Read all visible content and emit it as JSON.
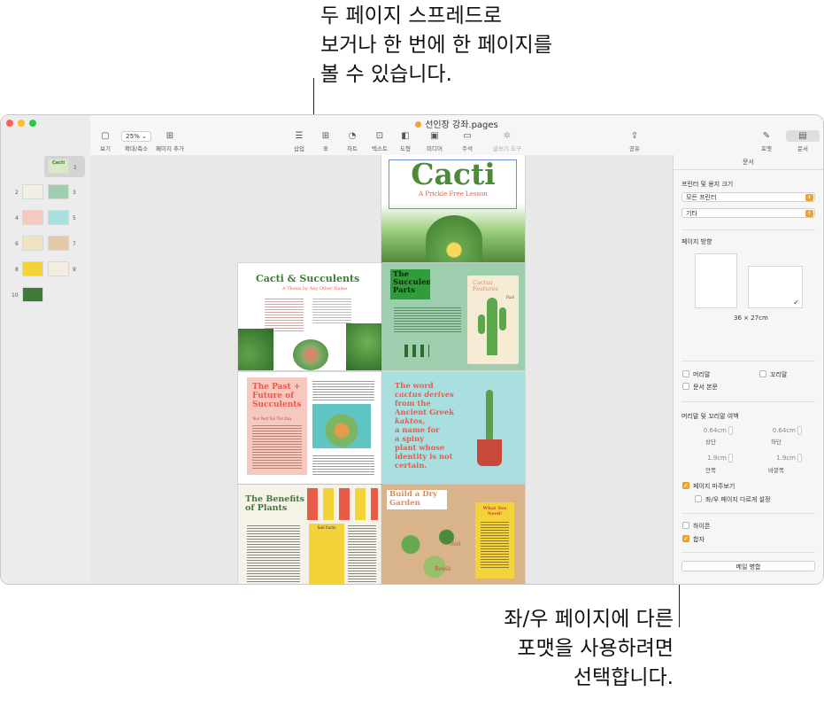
{
  "callouts": {
    "top": [
      "두 페이지 스프레드로",
      "보거나 한 번에 한 페이지를",
      "볼 수 있습니다."
    ],
    "bottom": [
      "좌/우 페이지에 다른",
      "포맷을 사용하려면",
      "선택합니다."
    ]
  },
  "window": {
    "title": "선인장 강좌.pages"
  },
  "toolbar": {
    "view": "보기",
    "zoom_value": "25%",
    "zoom_label": "확대/축소",
    "add_page": "페이지 추가",
    "insert": "삽입",
    "table": "표",
    "chart": "차트",
    "text": "텍스트",
    "shape": "도형",
    "media": "미디어",
    "comment": "주석",
    "writing_tools": "글쓰기 도구",
    "share": "공유",
    "format": "포맷",
    "document": "문서"
  },
  "sidebar": {
    "page_numbers": [
      "1",
      "2",
      "3",
      "4",
      "5",
      "6",
      "7",
      "8",
      "9",
      "10"
    ],
    "first_thumb_title": "Cacti"
  },
  "pages": {
    "p1": {
      "title": "Cacti",
      "subtitle": "A Prickle Free Lesson"
    },
    "p2": {
      "title": "Cacti & Succulents",
      "subtitle": "A Thesis by Any Other Name"
    },
    "p3": {
      "title": "The Succulent Parts",
      "side_title": "Cactus Features",
      "side_label": "Pad"
    },
    "p4": {
      "title": "The Past + Future of Succulents",
      "subhead": "Your Past Too This Day"
    },
    "p5": {
      "quote": [
        "The word",
        "cactus derives",
        "from the",
        "Ancient Greek",
        "kaktos,",
        "a name for",
        "a spiny",
        "plant whose",
        "identity is not",
        "certain."
      ]
    },
    "p6": {
      "title": "The Benefits of Plants",
      "sidebar_title": "Soil Facts"
    },
    "p7": {
      "title": "Build a Dry Garden",
      "card_title": "What You Need!",
      "label_soil": "Soil",
      "label_bowls": "Bowls"
    }
  },
  "inspector": {
    "tab": "문서",
    "printer_section": "프린터 및 용지 크기",
    "printer": "모든 프린터",
    "paper": "기타",
    "orientation_section": "페이지 방향",
    "paper_size": "36 × 27cm",
    "header": "머리말",
    "footer": "꼬리말",
    "body": "문서 본문",
    "margins_section": "머리말 및 꼬리말 여백",
    "top_value": "0.64cm",
    "top_label": "상단",
    "bottom_value": "0.64cm",
    "bottom_label": "하단",
    "inside_value": "1.9cm",
    "inside_label": "안쪽",
    "outside_value": "1.9cm",
    "outside_label": "바깥쪽",
    "facing_pages": "페이지 마주보기",
    "different_lr": "좌/우 페이지 다르게 설정",
    "hyphenation": "하이픈",
    "ligatures": "합자",
    "mail_merge": "메일 병합"
  },
  "colors": {
    "accent": "#f0a72e",
    "cacti_green": "#3f7a3a",
    "succulents_red": "#e85b4a",
    "past_future_bg": "#f5c9bf",
    "quote_bg": "#aadfe0",
    "yellow_card": "#f3d23a"
  }
}
